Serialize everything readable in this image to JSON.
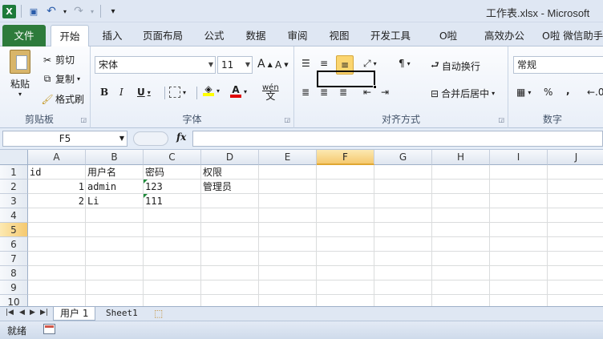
{
  "window": {
    "title": "工作表.xlsx - Microsoft"
  },
  "qat": {
    "logo": "X",
    "save": "💾",
    "undo": "↶",
    "redo": "↷",
    "customize": "▾"
  },
  "tabs": [
    "文件",
    "开始",
    "插入",
    "页面布局",
    "公式",
    "数据",
    "审阅",
    "视图",
    "开发工具",
    "O啦",
    "高效办公",
    "O啦 微信助手"
  ],
  "ribbon": {
    "clipboard": {
      "label": "剪贴板",
      "paste": "粘贴",
      "cut": "剪切",
      "copy": "复制",
      "format_painter": "格式刷"
    },
    "font": {
      "label": "字体",
      "font_name": "宋体",
      "font_size": "11",
      "grow": "A",
      "shrink": "A",
      "bold": "B",
      "italic": "I",
      "underline": "U",
      "phonetic": "wén\n文"
    },
    "alignment": {
      "label": "对齐方式",
      "wrap_text": "自动换行",
      "merge_center": "合并后居中"
    },
    "number": {
      "label": "数字",
      "format": "常规",
      "percent": "%",
      "comma": ","
    }
  },
  "formula_bar": {
    "name_box": "F5",
    "fx": "fx",
    "content": ""
  },
  "grid": {
    "columns": [
      "A",
      "B",
      "C",
      "D",
      "E",
      "F",
      "G",
      "H",
      "I",
      "J"
    ],
    "selected_column": "F",
    "rows": [
      "1",
      "2",
      "3",
      "4",
      "5",
      "6",
      "7",
      "8",
      "9",
      "10"
    ],
    "selected_row": "5",
    "cells": [
      {
        "ref": "A1",
        "value": "id"
      },
      {
        "ref": "B1",
        "value": "用户名"
      },
      {
        "ref": "C1",
        "value": "密码"
      },
      {
        "ref": "D1",
        "value": "权限"
      },
      {
        "ref": "A2",
        "value": "1",
        "numeric": true
      },
      {
        "ref": "B2",
        "value": "admin"
      },
      {
        "ref": "C2",
        "value": "123",
        "text_number_flag": true
      },
      {
        "ref": "D2",
        "value": "管理员"
      },
      {
        "ref": "A3",
        "value": "2",
        "numeric": true
      },
      {
        "ref": "B3",
        "value": "Li"
      },
      {
        "ref": "C3",
        "value": "111",
        "text_number_flag": true
      }
    ],
    "active_cell": "F5"
  },
  "sheets": {
    "tabs": [
      "用户 1",
      "Sheet1"
    ],
    "active": "用户 1"
  },
  "status": {
    "ready": "就绪"
  }
}
